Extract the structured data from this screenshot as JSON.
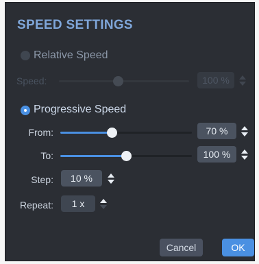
{
  "dialog": {
    "title": "SPEED SETTINGS"
  },
  "relative": {
    "label": "Relative Speed",
    "selected": false,
    "speed_label": "Speed:",
    "speed_value": "100 %",
    "speed_fraction": 0.45
  },
  "progressive": {
    "label": "Progressive Speed",
    "selected": true,
    "from_label": "From:",
    "from_value": "70 %",
    "from_fraction": 0.39,
    "to_label": "To:",
    "to_value": "100 %",
    "to_fraction": 0.5,
    "step_label": "Step:",
    "step_value": "10 %",
    "repeat_label": "Repeat:",
    "repeat_value": "1 x"
  },
  "buttons": {
    "cancel": "Cancel",
    "ok": "OK"
  },
  "colors": {
    "accent": "#4a90e2",
    "title": "#7fa6d9",
    "panel": "#2b2e34"
  }
}
